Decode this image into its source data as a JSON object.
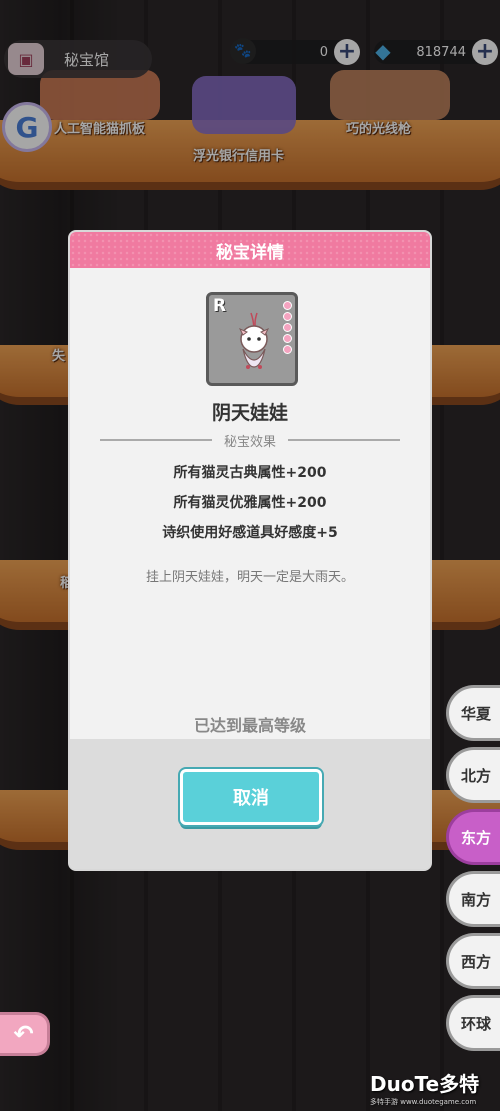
{
  "topbar": {
    "title": "秘宝馆",
    "currency_paw": "0",
    "currency_gem": "818744",
    "plus": "+"
  },
  "avatar": {
    "letter": "G"
  },
  "shelf": {
    "items": [
      "人工智能猫抓板",
      "浮光银行信用卡",
      "巧的光线枪"
    ],
    "partial_left_2": "失",
    "partial_left_3": "稻"
  },
  "modal": {
    "header": "秘宝详情",
    "rank": "R",
    "item_name": "阴天娃娃",
    "effect_label": "秘宝效果",
    "effects": [
      "所有猫灵古典属性+200",
      "所有猫灵优雅属性+200",
      "诗织使用好感道具好感度+5"
    ],
    "flavor": "挂上阴天娃娃，明天一定是大雨天。",
    "max_level": "已达到最高等级",
    "cancel": "取消"
  },
  "region_tabs": [
    "华夏",
    "北方",
    "东方",
    "南方",
    "西方",
    "环球"
  ],
  "active_region": "东方",
  "watermark": {
    "main": "DuoTe多特",
    "sub": "多特手游 www.duotegame.com"
  },
  "colors": {
    "header_pink": "#f07aa0",
    "cancel_teal": "#5ad0d9",
    "active_tab": "#c85fc8"
  }
}
